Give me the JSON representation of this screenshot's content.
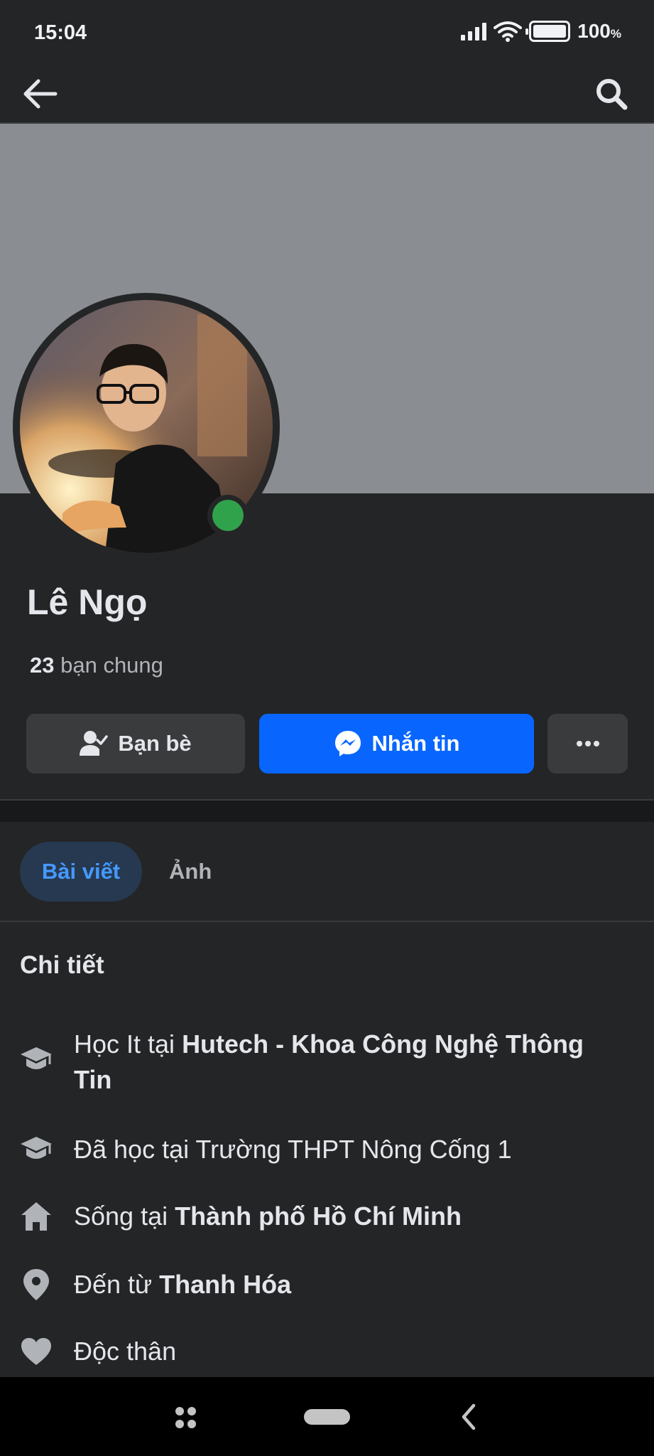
{
  "status_bar": {
    "time": "15:04",
    "battery": "100",
    "battery_unit": "%"
  },
  "profile": {
    "name": "Lê Ngọ",
    "mutual_count": "23",
    "mutual_label": "bạn chung",
    "online": true
  },
  "actions": {
    "friends_label": "Bạn bè",
    "message_label": "Nhắn tin"
  },
  "tabs": [
    {
      "label": "Bài viết",
      "active": true
    },
    {
      "label": "Ảnh",
      "active": false
    }
  ],
  "details": {
    "title": "Chi tiết",
    "items": [
      {
        "icon": "graduation-cap-icon",
        "prefix": "Học It tại ",
        "bold": "Hutech - Khoa Công Nghệ Thông Tin"
      },
      {
        "icon": "graduation-cap-icon",
        "prefix": "Đã học tại Trường THPT Nông Cống 1",
        "bold": ""
      },
      {
        "icon": "home-icon",
        "prefix": "Sống tại ",
        "bold": "Thành phố Hồ Chí Minh"
      },
      {
        "icon": "location-pin-icon",
        "prefix": "Đến từ ",
        "bold": "Thanh Hóa"
      },
      {
        "icon": "heart-icon",
        "prefix": "Độc thân",
        "bold": ""
      }
    ]
  },
  "colors": {
    "background": "#242526",
    "cover": "#8a8d91",
    "primary_button": "#0866ff",
    "online": "#31a24c",
    "active_tab_text": "#4599ff"
  }
}
